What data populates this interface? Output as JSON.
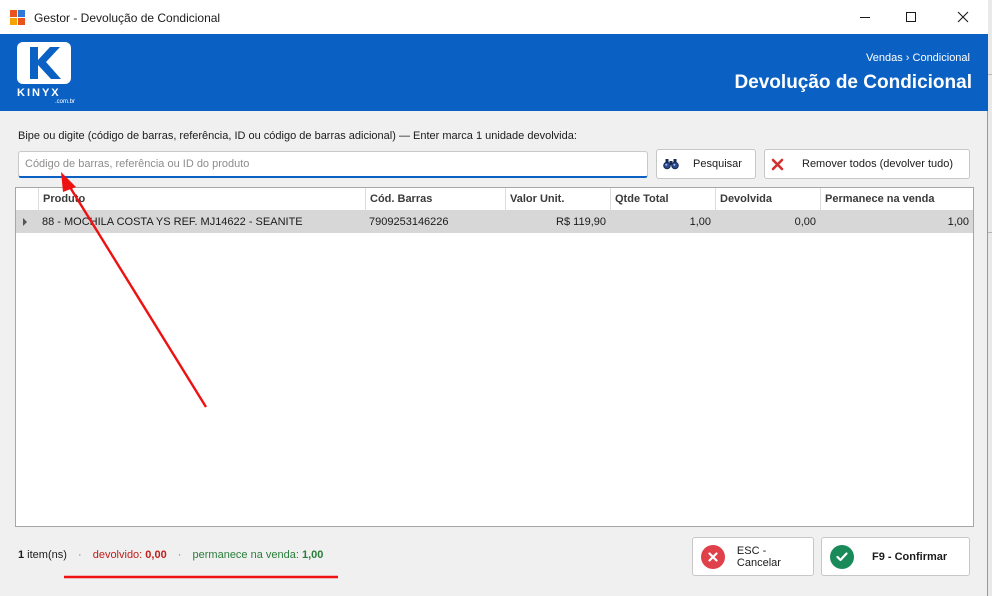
{
  "window": {
    "title": "Gestor - Devolução de Condicional",
    "icon": "app-grid-icon"
  },
  "header": {
    "logo_text": "KINYX",
    "logo_sub": ".com.br",
    "breadcrumb": "Vendas › Condicional",
    "title": "Devolução de Condicional",
    "background": "#0b61c3"
  },
  "instruction": "Bipe ou digite (código de barras, referência, ID ou código de barras adicional) — Enter marca 1 unidade devolvida:",
  "search": {
    "placeholder": "Código de barras, referência ou ID do produto",
    "value": ""
  },
  "buttons": {
    "search_label": "Pesquisar",
    "remove_all_label": "Remover todos (devolver tudo)",
    "cancel_label": "ESC - Cancelar",
    "confirm_label": "F9 - Confirmar"
  },
  "grid": {
    "columns": [
      "Produto",
      "Cód. Barras",
      "Valor Unit.",
      "Qtde Total",
      "Devolvida",
      "Permanece na venda"
    ],
    "rows": [
      {
        "produto": "88 - MOCHILA COSTA YS REF. MJ14622 - SEANITE",
        "cod_barras": "7909253146226",
        "valor_unit": "R$ 119,90",
        "qtde_total": "1,00",
        "devolvida": "0,00",
        "permanece": "1,00"
      }
    ]
  },
  "summary": {
    "count": "1",
    "count_suffix": " item(ns)",
    "separator": "·",
    "devolvido_label": "devolvido: ",
    "devolvido_value": "0,00",
    "permanece_label": "permanece na venda: ",
    "permanece_value": "1,00"
  },
  "colors": {
    "accent": "#0b61c3",
    "danger": "#c0201c",
    "success": "#2a7d3a",
    "annotation": "#ee1111"
  }
}
